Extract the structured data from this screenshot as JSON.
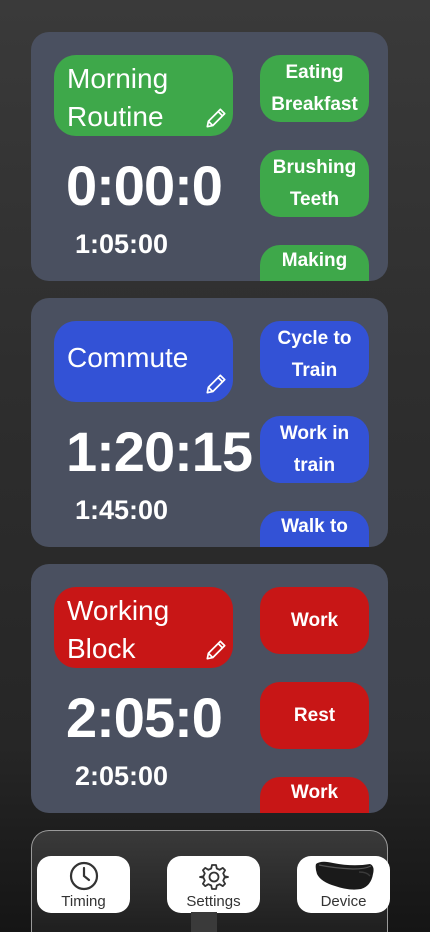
{
  "routines": [
    {
      "name": "Morning Routine",
      "elapsed": "0:00:0",
      "target": "1:05:00",
      "color": "#3ea84a",
      "steps": [
        "Eating Breakfast",
        "Brushing Teeth",
        "Making"
      ]
    },
    {
      "name": "Commute",
      "elapsed": "1:20:15",
      "target": "1:45:00",
      "color": "#3352d6",
      "steps": [
        "Cycle to Train",
        "Work in train",
        "Walk to"
      ]
    },
    {
      "name": "Working Block",
      "elapsed": "2:05:0",
      "target": "2:05:00",
      "color": "#c81616",
      "steps": [
        "Work",
        "Rest",
        "Work"
      ]
    }
  ],
  "nav": {
    "timing_label": "Timing",
    "settings_label": "Settings",
    "device_label": "Device",
    "timing_icon": "clock-icon",
    "settings_icon": "gear-icon",
    "device_icon": "device-icon"
  }
}
